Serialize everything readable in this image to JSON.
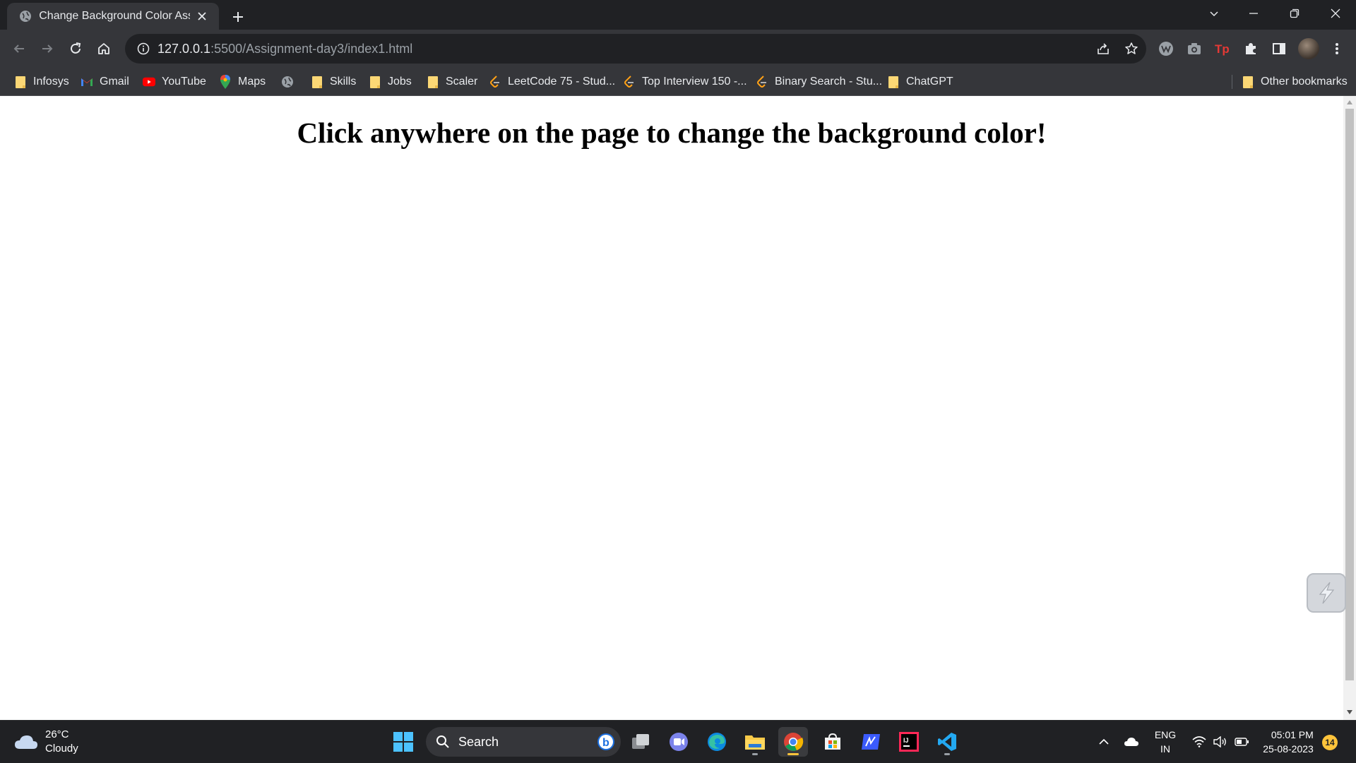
{
  "browser": {
    "tab": {
      "title": "Change Background Color Assignment"
    },
    "address_bar": {
      "host": "127.0.0.1",
      "rest": ":5500/Assignment-day3/index1.html"
    },
    "bookmarks": [
      {
        "label": "Infosys",
        "icon": "folder-icon"
      },
      {
        "label": "Gmail",
        "icon": "gmail-icon"
      },
      {
        "label": "YouTube",
        "icon": "youtube-icon"
      },
      {
        "label": "Maps",
        "icon": "maps-icon"
      },
      {
        "label": "",
        "icon": "globe-icon"
      },
      {
        "label": "Skills",
        "icon": "folder-icon"
      },
      {
        "label": "Jobs",
        "icon": "folder-icon"
      },
      {
        "label": "Scaler",
        "icon": "folder-icon"
      },
      {
        "label": "LeetCode 75 - Stud...",
        "icon": "leetcode-icon"
      },
      {
        "label": "Top Interview 150 -...",
        "icon": "leetcode-icon"
      },
      {
        "label": "Binary Search - Stu...",
        "icon": "leetcode-icon"
      },
      {
        "label": "ChatGPT",
        "icon": "folder-icon"
      }
    ],
    "other_bookmarks": "Other bookmarks"
  },
  "page": {
    "heading": "Click anywhere on the page to change the background color!"
  },
  "taskbar": {
    "weather": {
      "temp": "26°C",
      "condition": "Cloudy"
    },
    "search_label": "Search",
    "language": {
      "line1": "ENG",
      "line2": "IN"
    },
    "clock": {
      "time": "05:01 PM",
      "date": "25-08-2023"
    },
    "notification_count": "14"
  },
  "colors": {
    "chrome_dark": "#202124",
    "chrome_toolbar": "#35363a",
    "page_bg": "#ffffff",
    "folder_yellow": "#fbd775",
    "taskbar_accent": "#ffc43b"
  }
}
